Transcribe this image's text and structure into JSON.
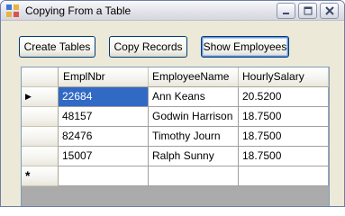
{
  "window": {
    "title": "Copying From a Table"
  },
  "toolbar": {
    "create_label": "Create Tables",
    "copy_label": "Copy Records",
    "show_label": "Show Employees"
  },
  "grid": {
    "columns": [
      "EmplNbr",
      "EmployeeName",
      "HourlySalary"
    ],
    "rows": [
      [
        "22684",
        "Ann Keans",
        "20.5200"
      ],
      [
        "48157",
        "Godwin Harrison",
        "18.7500"
      ],
      [
        "82476",
        "Timothy Journ",
        "18.7500"
      ],
      [
        "15007",
        "Ralph Sunny",
        "18.7500"
      ]
    ],
    "new_row_marker": "*",
    "current_row_marker": "▶"
  },
  "colors": {
    "selection": "#316AC5",
    "title_bar": "#E3E3EA"
  }
}
